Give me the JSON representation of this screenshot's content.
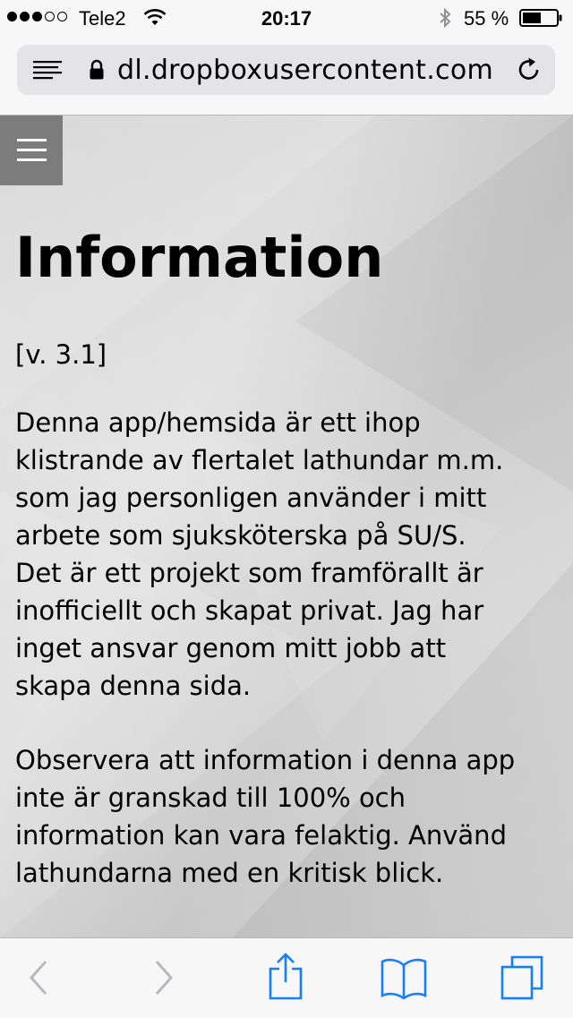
{
  "status_bar": {
    "carrier": "Tele2",
    "time": "20:17",
    "battery_percent": "55 %",
    "signal_bars_filled": 3,
    "signal_bars_total": 5,
    "battery_level": 0.55,
    "icons": [
      "signal-dots-icon",
      "wifi-icon",
      "bluetooth-icon",
      "battery-icon"
    ]
  },
  "address_bar": {
    "url": "dl.dropboxusercontent.com",
    "icons": [
      "reader-icon",
      "lock-icon",
      "reload-icon"
    ]
  },
  "page": {
    "title": "Information",
    "version": "[v. 3.1]",
    "paragraph1_lines": [
      "Denna app/hemsida är ett ihop",
      "klistrande av flertalet lathundar m.m.",
      "som jag personligen använder i mitt",
      "arbete som sjuksköterska på SU/S.",
      "Det är ett projekt som framförallt är",
      "inofficiellt och skapat privat. Jag har",
      "inget ansvar genom mitt jobb att",
      "skapa denna sida."
    ],
    "paragraph2_lines": [
      "Observera att information i denna app",
      "inte är granskad till 100% och",
      "information kan vara felaktig. Använd",
      "lathundarna med en kritisk blick."
    ],
    "menu_icon": "hamburger-icon"
  },
  "toolbar": {
    "icons": [
      "back-icon",
      "forward-icon",
      "share-icon",
      "bookmarks-icon",
      "tabs-icon"
    ],
    "accent_color": "#147efb",
    "disabled_color": "#b9b9bd"
  }
}
